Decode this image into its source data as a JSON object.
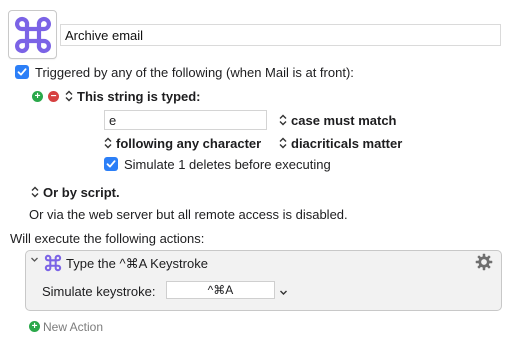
{
  "macro": {
    "name": "Archive email",
    "icon": "command-key-icon"
  },
  "trigger": {
    "header": "Triggered by any of the following (when Mail is at front):",
    "checked": true,
    "add_label": "+",
    "remove_label": "−",
    "typed_string_label": "This string is typed:",
    "typed_value": "e",
    "case_option": "case must match",
    "following_option": "following any character",
    "diacriticals_option": "diacriticals matter",
    "simulate_label": "Simulate 1 deletes before executing",
    "simulate_checked": true,
    "script_label": "Or by script.",
    "web_server_text": "Or via the web server but all remote access is disabled."
  },
  "actions": {
    "header": "Will execute the following actions:",
    "items": [
      {
        "title": "Type the ^⌘A Keystroke",
        "field_label": "Simulate keystroke:",
        "keystroke": "^⌘A",
        "icon": "command-key-icon"
      }
    ],
    "new_action_label": "New Action"
  },
  "colors": {
    "accent": "#2c7ff7",
    "add_green": "#2aa84a",
    "remove_red": "#d64040",
    "command_purple": "#7b63e6"
  }
}
